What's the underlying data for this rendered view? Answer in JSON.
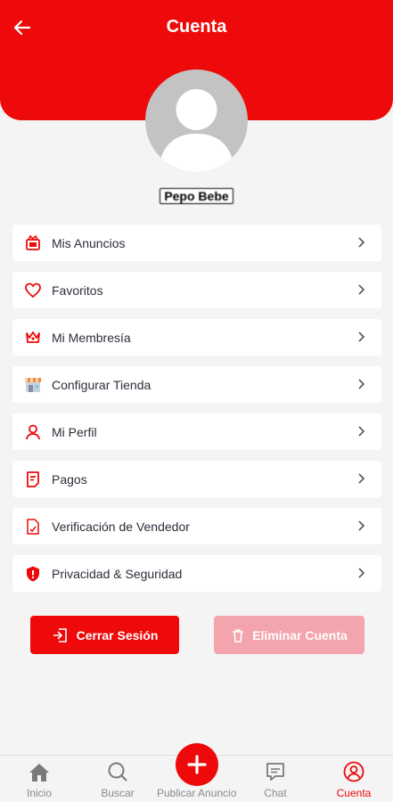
{
  "header": {
    "title": "Cuenta"
  },
  "profile": {
    "name": "Pepo Bebe"
  },
  "menu": {
    "items": [
      {
        "label": "Mis Anuncios",
        "icon": "ads-icon"
      },
      {
        "label": "Favoritos",
        "icon": "heart-icon"
      },
      {
        "label": "Mi Membresía",
        "icon": "crown-icon"
      },
      {
        "label": "Configurar Tienda",
        "icon": "store-icon"
      },
      {
        "label": "Mi Perfil",
        "icon": "user-icon"
      },
      {
        "label": "Pagos",
        "icon": "payment-icon"
      },
      {
        "label": "Verificación de Vendedor",
        "icon": "document-icon"
      },
      {
        "label": "Privacidad & Seguridad",
        "icon": "shield-icon"
      }
    ]
  },
  "actions": {
    "logout": "Cerrar Sesión",
    "delete": "Eliminar Cuenta"
  },
  "tabbar": {
    "inicio": "Inicio",
    "buscar": "Buscar",
    "publicar": "Publicar Anuncio",
    "chat": "Chat",
    "cuenta": "Cuenta"
  },
  "colors": {
    "accent": "#ee0a0a",
    "disabled": "#f4a4ac"
  }
}
